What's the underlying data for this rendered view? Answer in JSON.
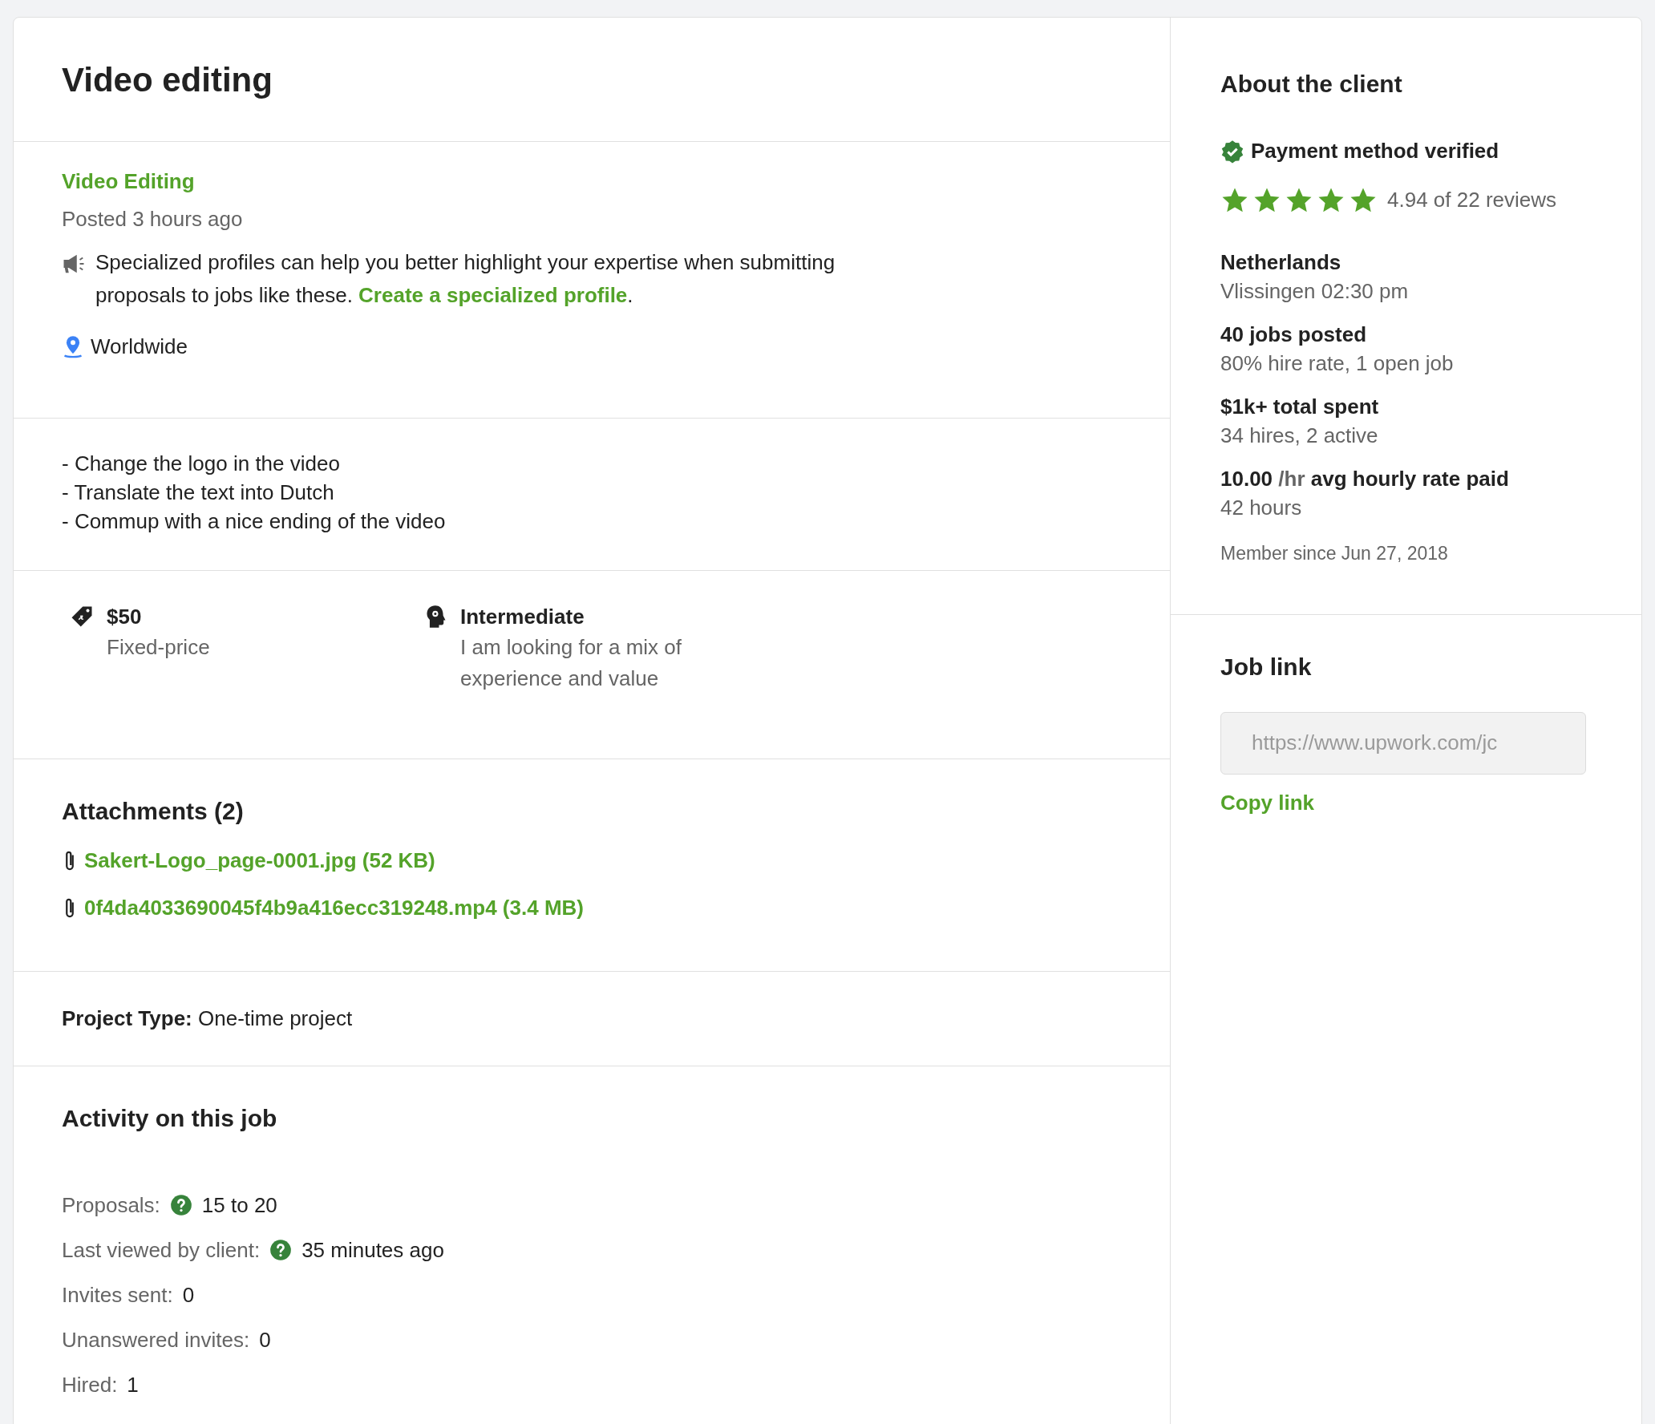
{
  "job": {
    "title": "Video editing",
    "category": "Video Editing",
    "posted": "Posted 3 hours ago",
    "tip": {
      "text": "Specialized profiles can help you better highlight your expertise when submitting proposals to jobs like these. ",
      "link": "Create a specialized profile",
      "after": "."
    },
    "location": "Worldwide",
    "description": [
      "- Change the logo in the video",
      "- Translate the text into Dutch",
      "- Commup with a nice ending of the video"
    ],
    "features": [
      {
        "kind": "budget",
        "title": "$50",
        "subtitle": "Fixed-price"
      },
      {
        "kind": "level",
        "title": "Intermediate",
        "subtitle": "I am looking for a mix of experience and value"
      }
    ],
    "attachments": {
      "heading": "Attachments (2)",
      "files": [
        "Sakert-Logo_page-0001.jpg (52 KB)",
        "0f4da4033690045f4b9a416ecc319248.mp4 (3.4 MB)"
      ]
    },
    "project_type": "**Project Type:** One-time project",
    "activity": {
      "heading": "Activity on this job",
      "rows": [
        {
          "label": "Proposals:",
          "value": "15 to 20",
          "help": true
        },
        {
          "label": "Last viewed by client:",
          "value": "35 minutes ago",
          "help": true
        },
        {
          "label": "Invites sent:",
          "value": "0",
          "help": false
        },
        {
          "label": "Unanswered invites:",
          "value": "0",
          "help": false
        },
        {
          "label": "Hired:",
          "value": "1",
          "help": false
        }
      ]
    }
  },
  "client": {
    "heading": "About the client",
    "verified": true,
    "verified_label": "Payment method verified",
    "stars": 5,
    "rating": "4.94 of 22 reviews",
    "stats": [
      {
        "title": "Netherlands",
        "detail": "Vlissingen 02:30 pm"
      },
      {
        "title": "40 jobs posted",
        "detail": "80% hire rate, 1 open job"
      },
      {
        "title": "$1k+ total spent",
        "detail": "34 hires, 2 active"
      },
      {
        "title": "10.00",
        "unit": "/hr",
        "title_after": "avg hourly rate paid",
        "detail": "42 hours"
      }
    ],
    "member_since": "Member since Jun 27, 2018"
  },
  "job_link": {
    "heading": "Job link",
    "value": "https://www.upwork.com/jc",
    "copy": "Copy link"
  }
}
